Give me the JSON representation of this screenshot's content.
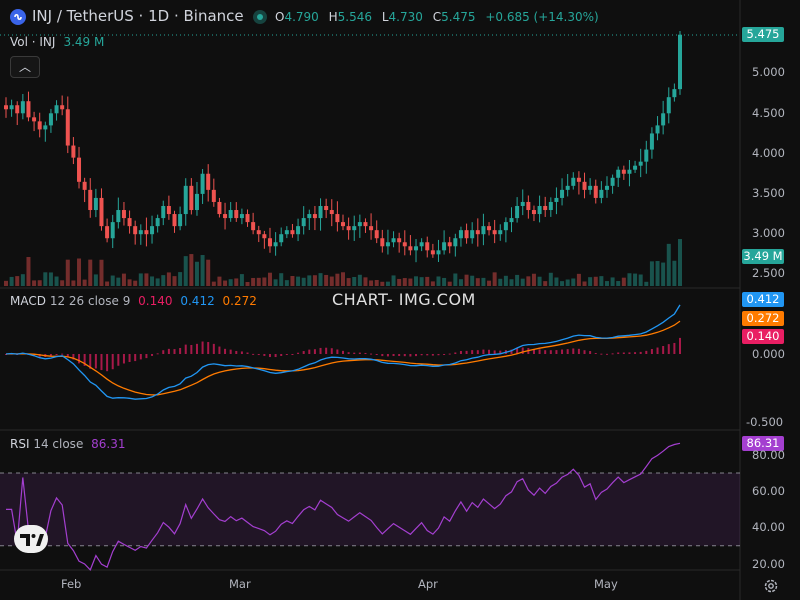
{
  "header": {
    "title": "INJ / TetherUS · 1D · Binance",
    "ohlc": [
      {
        "key": "O",
        "value": "4.790"
      },
      {
        "key": "H",
        "value": "5.546"
      },
      {
        "key": "L",
        "value": "4.730"
      },
      {
        "key": "C",
        "value": "5.475"
      }
    ],
    "change": "+0.685 (+14.30%)",
    "status_color": "#26a69a"
  },
  "volume": {
    "label": "Vol · INJ",
    "value": "3.49 M"
  },
  "macd": {
    "label": "MACD",
    "params": "12 26 close 9",
    "hist": "0.140",
    "macd": "0.412",
    "signal": "0.272"
  },
  "rsi": {
    "label": "RSI",
    "params": "14 close",
    "value": "86.31"
  },
  "watermark": "CHART- IMG.COM",
  "colors": {
    "up": "#26a69a",
    "down": "#ef5350",
    "macd": "#2196f3",
    "signal": "#ff7b00",
    "hist": "#e91e63",
    "rsi": "#a43fd0"
  },
  "chart_data": [
    {
      "type": "candlestick",
      "x_axis": {
        "type": "date",
        "ticks": [
          "Feb",
          "Mar",
          "Apr",
          "May"
        ]
      },
      "y_axis": {
        "ticks": [
          "5.000",
          "4.500",
          "4.000",
          "3.500",
          "3.000",
          "2.500"
        ],
        "last_value": "5.475"
      },
      "grid": false,
      "close": [
        4.55,
        4.6,
        4.5,
        4.65,
        4.45,
        4.4,
        4.3,
        4.35,
        4.5,
        4.6,
        4.55,
        4.1,
        3.95,
        3.65,
        3.55,
        3.3,
        3.45,
        3.1,
        2.95,
        3.15,
        3.3,
        3.2,
        3.1,
        3.0,
        3.05,
        3.0,
        3.1,
        3.2,
        3.35,
        3.25,
        3.1,
        3.25,
        3.6,
        3.3,
        3.5,
        3.75,
        3.55,
        3.4,
        3.25,
        3.2,
        3.3,
        3.2,
        3.25,
        3.15,
        3.05,
        3.0,
        2.95,
        2.85,
        2.9,
        3.0,
        3.05,
        3.0,
        3.1,
        3.2,
        3.25,
        3.2,
        3.35,
        3.3,
        3.25,
        3.15,
        3.1,
        3.05,
        3.1,
        3.15,
        3.1,
        3.05,
        2.95,
        2.85,
        2.9,
        2.95,
        2.9,
        2.85,
        2.8,
        2.85,
        2.9,
        2.8,
        2.75,
        2.8,
        2.9,
        2.85,
        2.95,
        3.05,
        2.95,
        3.05,
        3.0,
        3.1,
        3.05,
        3.0,
        3.05,
        3.15,
        3.2,
        3.35,
        3.4,
        3.3,
        3.25,
        3.35,
        3.3,
        3.4,
        3.45,
        3.55,
        3.6,
        3.7,
        3.65,
        3.55,
        3.6,
        3.45,
        3.55,
        3.6,
        3.7,
        3.8,
        3.75,
        3.8,
        3.85,
        3.9,
        4.05,
        4.25,
        4.35,
        4.5,
        4.7,
        4.8,
        5.475
      ],
      "series": [
        {
          "name": "Vol · INJ",
          "last": "3.49 M"
        }
      ]
    },
    {
      "type": "line",
      "title": "MACD 12 26 close 9",
      "y_axis": {
        "ticks": [
          "0.000",
          "-0.500"
        ]
      },
      "series": [
        {
          "name": "MACD",
          "color": "#2196f3",
          "last": 0.412
        },
        {
          "name": "Signal",
          "color": "#ff7b00",
          "last": 0.272
        },
        {
          "name": "Histogram",
          "color": "#e91e63",
          "last": 0.14
        }
      ]
    },
    {
      "type": "line",
      "title": "RSI 14 close",
      "y_axis": {
        "ticks": [
          "80.00",
          "60.00",
          "40.00",
          "20.00"
        ],
        "bands": [
          30,
          70
        ]
      },
      "series": [
        {
          "name": "RSI",
          "color": "#a43fd0",
          "last": 86.31
        }
      ]
    }
  ]
}
